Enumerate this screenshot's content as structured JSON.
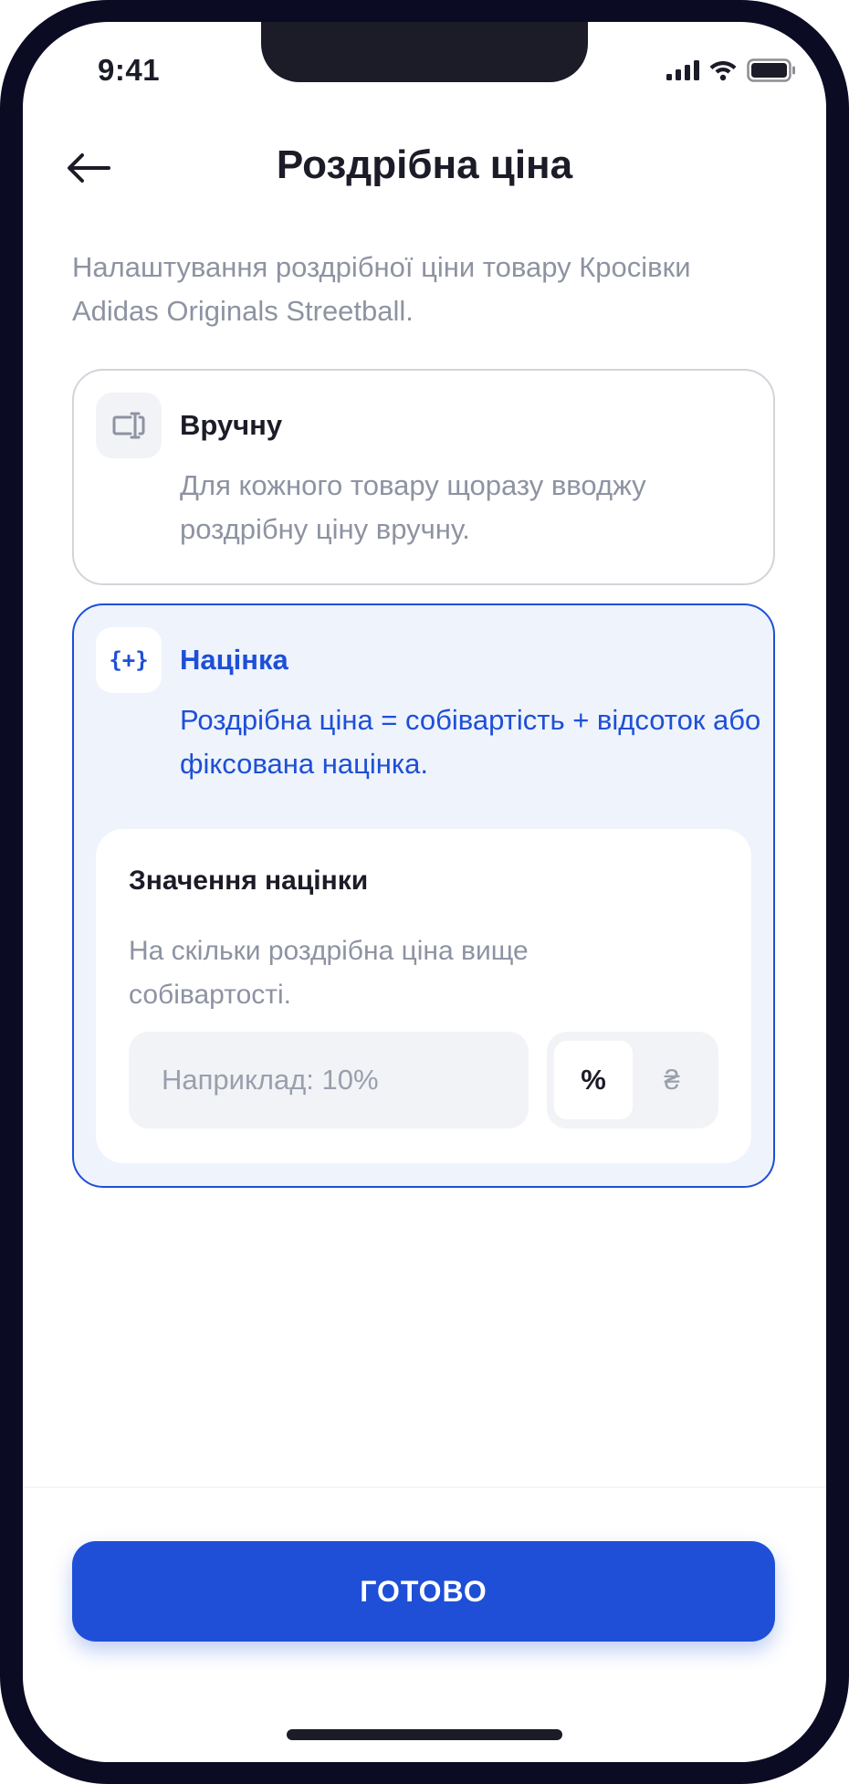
{
  "status_bar": {
    "time": "9:41",
    "icons": [
      "signal-icon",
      "wifi-icon",
      "battery-icon"
    ]
  },
  "header": {
    "back_icon": "arrow-left-icon",
    "title": "Роздрібна ціна"
  },
  "intro_text": "Налаштування роздрібної ціни товару Кросівки Adidas Originals Streetball.",
  "options": [
    {
      "icon": "text-cursor-icon",
      "title": "Вручну",
      "description": "Для кожного товару щоразу вводжу роздрібну ціну вручну.",
      "selected": false
    },
    {
      "icon": "plus-braces-icon",
      "icon_text": "{+}",
      "title": "Націнка",
      "description": "Роздрібна ціна = собівартість + відсоток або фіксована націнка.",
      "selected": true
    }
  ],
  "markup_panel": {
    "title": "Значення націнки",
    "description": "На скільки роздрібна ціна вище собівартості.",
    "input_value": "",
    "input_placeholder": "Наприклад: 10%",
    "units": [
      {
        "label": "%",
        "active": true
      },
      {
        "label": "₴",
        "active": false
      }
    ]
  },
  "footer": {
    "done_label": "ГОТОВО"
  },
  "colors": {
    "accent": "#1e4fd6",
    "selected_bg": "#eef3fc",
    "muted_text": "#8e93a2",
    "primary_text": "#1c1c28",
    "device_frame": "#0b0b24"
  }
}
